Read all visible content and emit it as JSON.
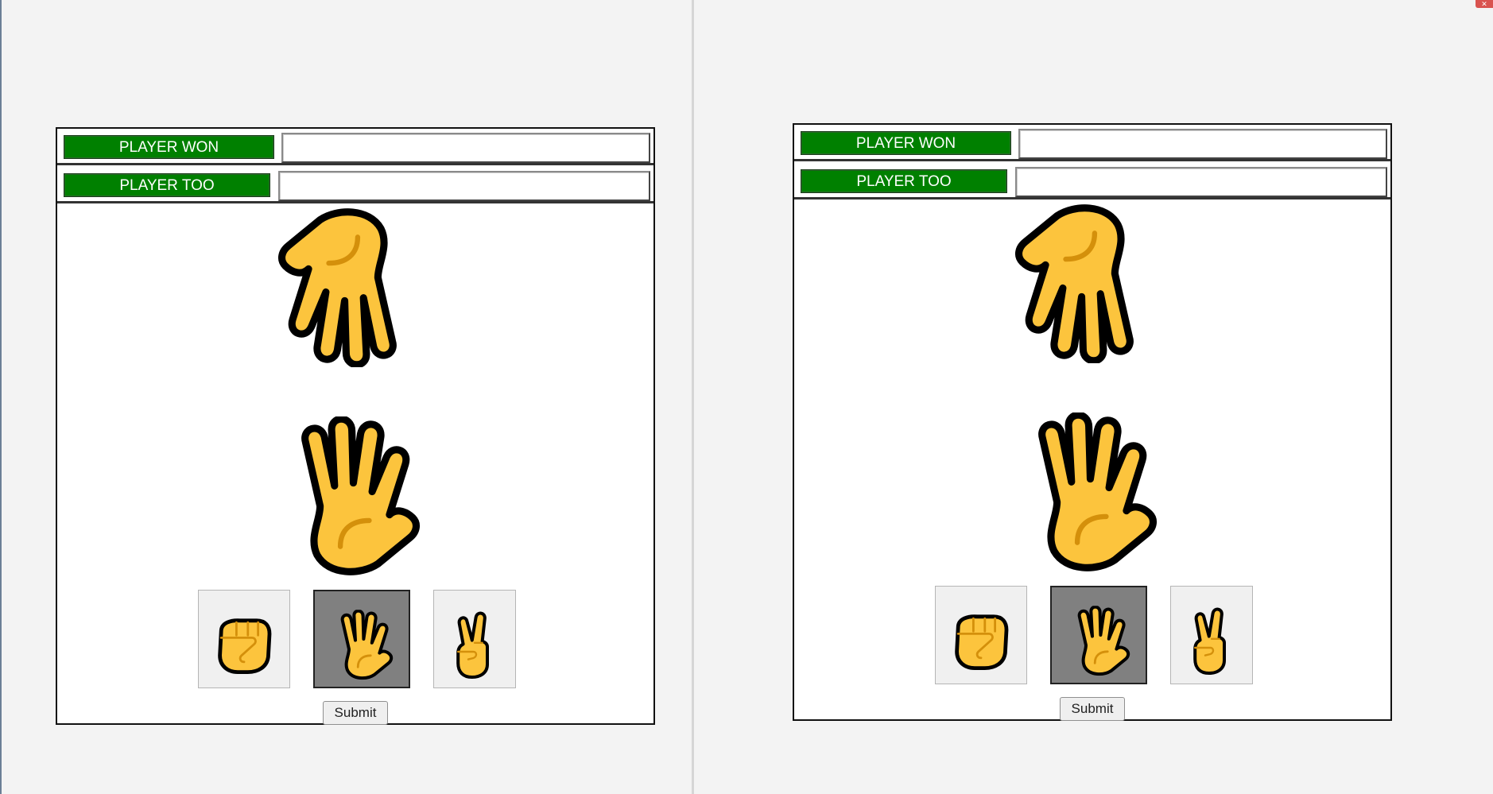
{
  "boards": [
    {
      "player1": {
        "label": "PLAYER WON",
        "value": ""
      },
      "player2": {
        "label": "PLAYER TOO",
        "value": ""
      },
      "opponent_hand": "paper-hand-icon",
      "player_hand": "paper-hand-icon",
      "choices": [
        {
          "name": "rock",
          "icon": "rock-fist-icon",
          "selected": false
        },
        {
          "name": "paper",
          "icon": "paper-hand-icon",
          "selected": true
        },
        {
          "name": "scissors",
          "icon": "scissors-victory-icon",
          "selected": false
        }
      ],
      "submit_label": "Submit"
    },
    {
      "player1": {
        "label": "PLAYER WON",
        "value": ""
      },
      "player2": {
        "label": "PLAYER TOO",
        "value": ""
      },
      "opponent_hand": "paper-hand-icon",
      "player_hand": "paper-hand-icon",
      "choices": [
        {
          "name": "rock",
          "icon": "rock-fist-icon",
          "selected": false
        },
        {
          "name": "paper",
          "icon": "paper-hand-icon",
          "selected": true
        },
        {
          "name": "scissors",
          "icon": "scissors-victory-icon",
          "selected": false
        }
      ],
      "submit_label": "Submit"
    }
  ],
  "colors": {
    "label_bg": "#008000",
    "label_text": "#ffffff",
    "selected_choice_bg": "#808080",
    "emoji_skin": "#FCC43D",
    "emoji_outline": "#000000",
    "emoji_crease": "#D4900B"
  }
}
